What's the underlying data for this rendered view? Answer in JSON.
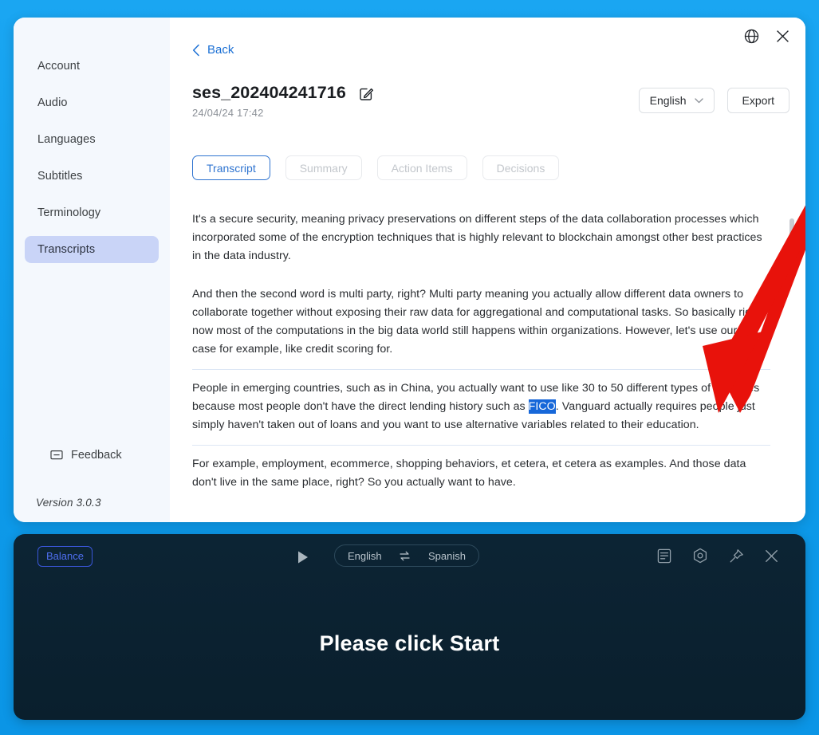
{
  "sidebar": {
    "items": [
      {
        "label": "Account",
        "name": "account"
      },
      {
        "label": "Audio",
        "name": "audio"
      },
      {
        "label": "Languages",
        "name": "languages"
      },
      {
        "label": "Subtitles",
        "name": "subtitles"
      },
      {
        "label": "Terminology",
        "name": "terminology"
      },
      {
        "label": "Transcripts",
        "name": "transcripts"
      }
    ],
    "feedback_label": "Feedback",
    "version_label": "Version 3.0.3"
  },
  "window_controls": {
    "globe_icon": "globe-icon",
    "close_icon": "close-icon"
  },
  "header": {
    "back_label": "Back",
    "title": "ses_202404241716",
    "date": "24/04/24 17:42",
    "edit_icon": "edit-pencil-icon",
    "language_select": "English",
    "export_label": "Export"
  },
  "tabs": [
    {
      "label": "Transcript",
      "active": true
    },
    {
      "label": "Summary",
      "active": false
    },
    {
      "label": "Action Items",
      "active": false
    },
    {
      "label": "Decisions",
      "active": false
    }
  ],
  "transcript": {
    "paragraphs": [
      {
        "text": "It's a secure security, meaning privacy preservations on different steps of the data collaboration processes which incorporated some of the encryption techniques that is highly relevant to blockchain amongst other best practices in the data industry.",
        "selected": false
      },
      {
        "text": "And then the second word is multi party, right? Multi party meaning you actually allow different data owners to collaborate together without exposing their raw data for aggregational and computational tasks. So basically right now most of the computations in the big data world still happens within organizations. However, let's use our use case for example, like credit scoring for.",
        "selected": false
      },
      {
        "selected": true,
        "before": "People in emerging countries, such as in China, you actually want to use like 30 to 50 different types of variables because most people don't have the direct lending history such as ",
        "highlight": "FICO",
        "after": ". Vanguard actually requires people just simply haven't taken out of loans and you want to use alternative variables related to their education."
      },
      {
        "text": "For example, employment, ecommerce, shopping behaviors, et cetera, et cetera as examples. And those data don't live in the same place, right? So you actually want to have.",
        "selected": false
      }
    ]
  },
  "overlay_panel": {
    "balance_label": "Balance",
    "play_icon": "play-icon",
    "source_language": "English",
    "swap_icon": "swap-arrows-icon",
    "target_language": "Spanish",
    "tools": [
      {
        "icon": "transcript-document-icon"
      },
      {
        "icon": "settings-gear-icon"
      },
      {
        "icon": "pin-icon"
      },
      {
        "icon": "close-icon"
      }
    ],
    "message": "Please click Start"
  },
  "annotation": {
    "arrow_color": "#e8120b"
  },
  "colors": {
    "desktop_background": "#0e9bea",
    "accent_blue": "#2f74d0",
    "selection_blue": "#1667d9",
    "sidebar_active": "#c9d4f7",
    "panel_dark": "#0c2231"
  }
}
